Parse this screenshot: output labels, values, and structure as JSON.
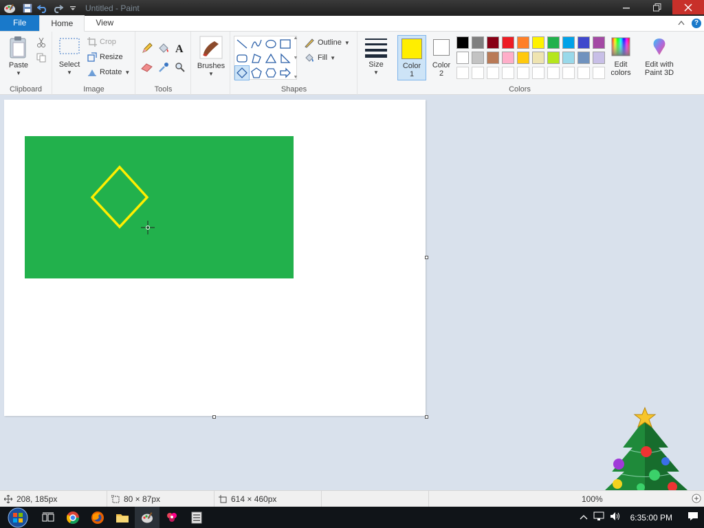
{
  "window": {
    "title": "Untitled - Paint"
  },
  "tabs": [
    {
      "label": "File"
    },
    {
      "label": "Home"
    },
    {
      "label": "View"
    }
  ],
  "clipboard": {
    "paste_label": "Paste",
    "group_label": "Clipboard"
  },
  "image": {
    "select_label": "Select",
    "crop_label": "Crop",
    "resize_label": "Resize",
    "rotate_label": "Rotate",
    "group_label": "Image"
  },
  "tools": {
    "group_label": "Tools",
    "brushes_label": "Brushes"
  },
  "shapes": {
    "outline_label": "Outline",
    "fill_label": "Fill",
    "group_label": "Shapes"
  },
  "size": {
    "label": "Size"
  },
  "colors": {
    "color1_label_line1": "Color",
    "color1_label_line2": "1",
    "color2_label_line1": "Color",
    "color2_label_line2": "2",
    "color1_value": "#ffee00",
    "color2_value": "#ffffff",
    "edit_colors_line1": "Edit",
    "edit_colors_line2": "colors",
    "paint3d_line1": "Edit with",
    "paint3d_line2": "Paint 3D",
    "group_label": "Colors",
    "palette_row1": [
      "#000000",
      "#7f7f7f",
      "#880015",
      "#ed1c24",
      "#ff7f27",
      "#fff200",
      "#22b14c",
      "#00a2e8",
      "#3f48cc",
      "#a349a4"
    ],
    "palette_row2": [
      "#ffffff",
      "#c3c3c3",
      "#b97a57",
      "#ffaec9",
      "#ffc90e",
      "#efe4b0",
      "#b5e61d",
      "#99d9ea",
      "#7092be",
      "#c8bfe7"
    ]
  },
  "canvas": {
    "rect_fill": "#22b14c",
    "diamond_stroke": "#ffee00"
  },
  "statusbar": {
    "cursor_pos": "208, 185px",
    "selection_size": "80 × 87px",
    "image_size": "614 × 460px",
    "zoom": "100%"
  },
  "taskbar": {
    "time": "6:35:00 PM"
  }
}
